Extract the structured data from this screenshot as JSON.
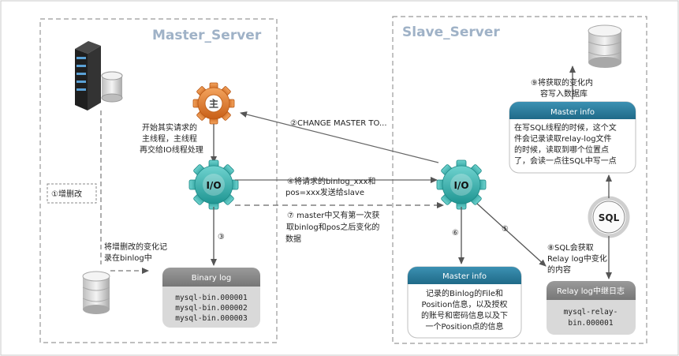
{
  "master": {
    "title": "Master_Server",
    "gear_main_label": "主",
    "gear_io_label": "I/O",
    "main_thread_note": [
      "开始其实请求的",
      "主线程，主线程",
      "再交给IO线程处理"
    ],
    "step1_label": "①增删改",
    "step1_note": [
      "将增删改的变化记",
      "录在binlog中"
    ],
    "step3_marker": "③",
    "binary_log": {
      "header": "Binary log",
      "files": [
        "mysql-bin.000001",
        "mysql-bin.000002",
        "mysql-bin.000003"
      ]
    }
  },
  "slave": {
    "title": "Slave_Server",
    "gear_io_label": "I/O",
    "sql_label": "SQL",
    "step6_marker": "⑥",
    "step5_marker": "⑤",
    "step9_note": [
      "⑨将获取的变化内",
      "容写入数据库"
    ],
    "step8_note": [
      "⑧SQL会获取",
      "Relay log中变化",
      "的内容"
    ],
    "master_info_top": {
      "header": "Master info",
      "lines": [
        "在写SQL线程的时候，这个文",
        "件会记录读取relay-log文件",
        "的时候，读取到哪个位置点",
        "了，会读一点往SQL中写一点"
      ]
    },
    "master_info_bottom": {
      "header": "Master info",
      "lines": [
        "记录的Binlog的File和",
        "Position信息，以及授权",
        "的账号和密码信息以及下",
        "一个Position点的信息"
      ]
    },
    "relay_log": {
      "header": "Relay log中继日志",
      "lines": [
        "mysql-relay-",
        "bin.000001"
      ]
    }
  },
  "arrows": {
    "step2": "②CHANGE MASTER TO...",
    "step4": [
      "④将请求的binlog_xxx和",
      "pos=xxx发送给slave"
    ],
    "step7": [
      "⑦  master中又有第一次获",
      "取binlog和pos之后变化的",
      "数据"
    ]
  },
  "colors": {
    "gear_orange": "#e07b2e",
    "gear_teal": "#2bb0ad",
    "box_gray": "#d7d7d7",
    "box_header": "#8a8a8a",
    "info_header": "#2a7d9e",
    "title_blue": "#9fb2c7",
    "arrow": "#666666"
  }
}
